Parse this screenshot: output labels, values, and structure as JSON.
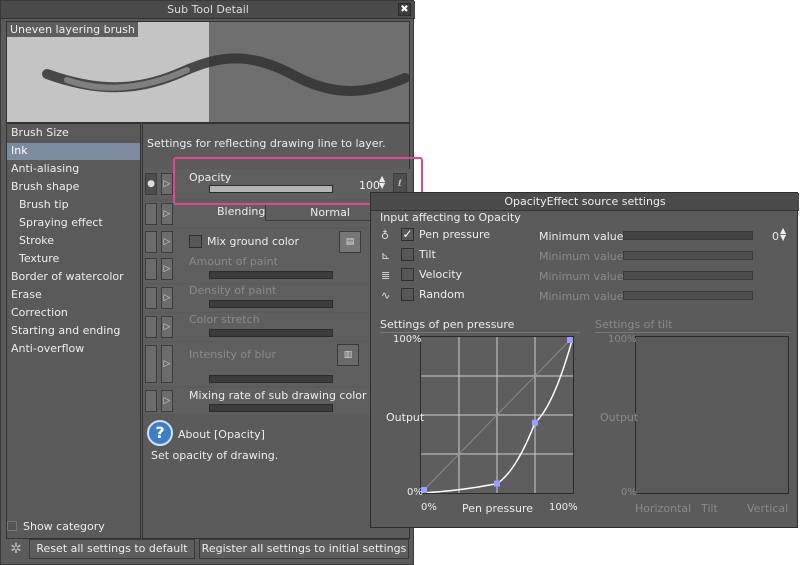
{
  "window": {
    "title": "Sub Tool Detail",
    "close_glyph": "✖"
  },
  "preview": {
    "label": "Uneven layering brush"
  },
  "categories": [
    {
      "label": "Brush Size"
    },
    {
      "label": "Ink",
      "selected": true
    },
    {
      "label": "Anti-aliasing"
    },
    {
      "label": "Brush shape"
    },
    {
      "label": "Brush tip",
      "indent": true
    },
    {
      "label": "Spraying effect",
      "indent": true
    },
    {
      "label": "Stroke",
      "indent": true
    },
    {
      "label": "Texture",
      "indent": true
    },
    {
      "label": "Border of watercolor"
    },
    {
      "label": "Erase"
    },
    {
      "label": "Correction"
    },
    {
      "label": "Starting and ending"
    },
    {
      "label": "Anti-overflow"
    }
  ],
  "show_category": "Show category",
  "settings": {
    "description": "Settings for reflecting drawing line to layer.",
    "opacity": {
      "label": "Opacity",
      "value": "100",
      "fill_fraction": 1.0
    },
    "blending_mode": {
      "label": "Blending mode",
      "value": "Normal"
    },
    "mix_ground_color": {
      "label": "Mix ground color"
    },
    "amount_of_paint": {
      "label": "Amount of paint"
    },
    "density_of_paint": {
      "label": "Density of paint"
    },
    "color_stretch": {
      "label": "Color stretch"
    },
    "intensity_of_blur": {
      "label": "Intensity of blur"
    },
    "mixing_rate": {
      "label": "Mixing rate of sub drawing color"
    }
  },
  "about": {
    "title": "About [Opacity]",
    "text": "Set opacity of drawing."
  },
  "buttons": {
    "reset": "Reset all settings to default",
    "register": "Register all settings to initial settings"
  },
  "popup": {
    "title": "OpacityEffect source settings",
    "section": "Input affecting to Opacity",
    "inputs": [
      {
        "label": "Pen pressure",
        "checked": true,
        "min_label": "Minimum value",
        "min_value": "0"
      },
      {
        "label": "Tilt",
        "checked": false,
        "min_label": "Minimum value"
      },
      {
        "label": "Velocity",
        "checked": false,
        "min_label": "Minimum value"
      },
      {
        "label": "Random",
        "checked": false,
        "min_label": "Minimum value"
      }
    ],
    "pressure_graph": {
      "title": "Settings of pen pressure",
      "y_top": "100%",
      "y_mid": "Output",
      "y_bottom": "0%",
      "x_left": "0%",
      "x_mid": "Pen pressure",
      "x_right": "100%",
      "control_points": [
        [
          0,
          0
        ],
        [
          50,
          6
        ],
        [
          75,
          45
        ],
        [
          100,
          100
        ]
      ]
    },
    "tilt_graph": {
      "title": "Settings of tilt",
      "y_top": "100%",
      "y_mid": "Output",
      "y_bottom": "0%",
      "x_left": "Horizontal",
      "x_mid": "Tilt",
      "x_right": "Vertical"
    }
  },
  "colors": {
    "highlight": "#e0488d",
    "selection": "#7d8ba0",
    "curve_point": "#9aa0ff"
  }
}
